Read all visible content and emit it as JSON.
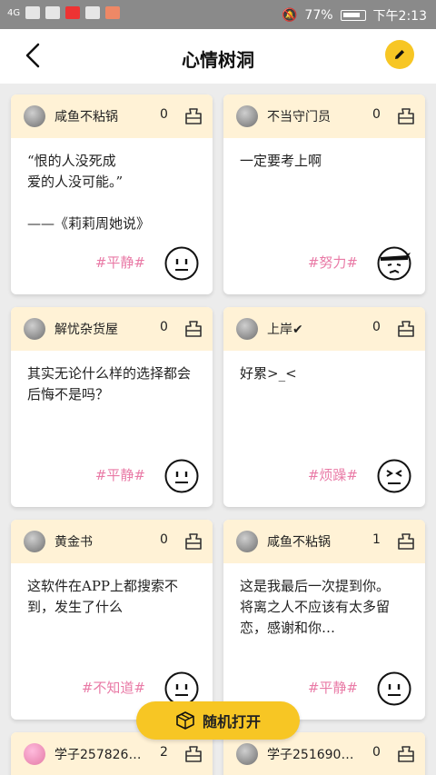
{
  "status": {
    "carrier": "4G",
    "battery": "77%",
    "time": "下午2:13"
  },
  "header": {
    "title": "心情树洞"
  },
  "cards": [
    {
      "user": "咸鱼不粘锅",
      "likes": "0",
      "content": "“恨的人没死成\n  爱的人没可能。”\n\n——《莉莉周她说》",
      "tag": "#平静#",
      "mood": "calm"
    },
    {
      "user": "不当守门员",
      "likes": "0",
      "content": "一定要考上啊",
      "tag": "#努力#",
      "mood": "effort"
    },
    {
      "user": "解忧杂货屋",
      "likes": "0",
      "content": "其实无论什么样的选择都会后悔不是吗？",
      "tag": "#平静#",
      "mood": "calm"
    },
    {
      "user": "上岸✔",
      "likes": "0",
      "content": "好累>_<",
      "tag": "#烦躁#",
      "mood": "annoyed"
    },
    {
      "user": "黄金书",
      "likes": "0",
      "content": "这软件在APP上都搜索不到，发生了什么",
      "tag": "#不知道#",
      "mood": "calm"
    },
    {
      "user": "咸鱼不粘锅",
      "likes": "1",
      "content": "这是我最后一次提到你。\n将离之人不应该有太多留恋，感谢和你…",
      "tag": "#平静#",
      "mood": "calm"
    },
    {
      "user": "学子257826…",
      "likes": "2"
    },
    {
      "user": "学子251690…",
      "likes": "0"
    }
  ],
  "random_button": {
    "label": "随机打开"
  },
  "colors": {
    "accent": "#f7c624",
    "strip": "#fff2d6",
    "tag": "#e97aa6"
  }
}
